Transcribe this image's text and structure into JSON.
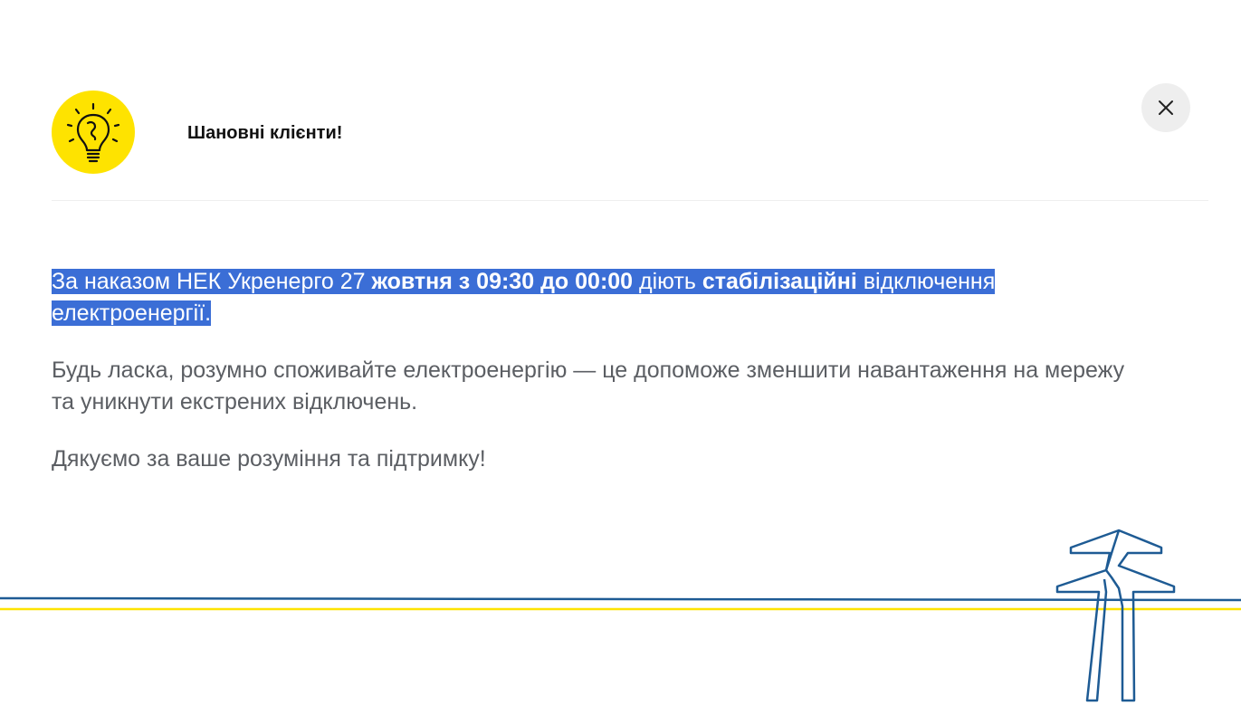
{
  "modal": {
    "title": "Шановні клієнти!",
    "close_icon": "close-icon",
    "header_icon": "lightbulb-icon"
  },
  "message": {
    "p1_a": "За наказом НЕК Укренерго 27 ",
    "p1_b": "жовтня з 09:30 до 00:00",
    "p1_c": " діють ",
    "p1_d": "стабілізаційні",
    "p1_e": " відключення електроенергії.",
    "p2": "Будь ласка, розумно споживайте електроенергію — це допоможе зменшити навантаження на мережу та уникнути екстрених відключень.",
    "p3": "Дякуємо за ваше розуміння та підтримку!"
  },
  "colors": {
    "accent_yellow": "#fee300",
    "accent_blue": "#1e5b94",
    "selection": "#3b6ed6",
    "text": "#5b5e63"
  },
  "decoration": {
    "icon": "power-pylon-icon"
  }
}
